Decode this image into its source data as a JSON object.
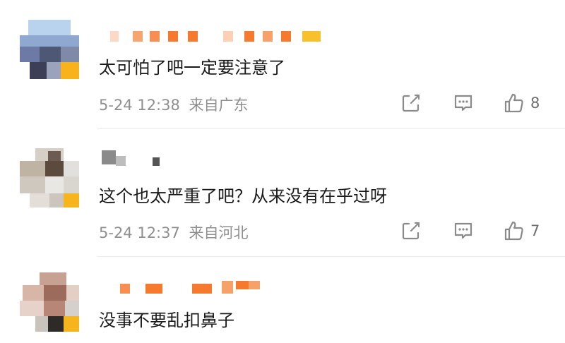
{
  "comments": [
    {
      "text": "太可怕了吧一定要注意了",
      "timestamp": "5-24 12:38",
      "location": "来自广东",
      "likes": "8"
    },
    {
      "text": "这个也太严重了吧？从来没有在乎过呀",
      "timestamp": "5-24 12:37",
      "location": "来自河北",
      "likes": "7"
    },
    {
      "text": "没事不要乱扣鼻子"
    }
  ],
  "colors": {
    "text": "#1a1a1a",
    "meta": "#8f8f8f",
    "nickname_orange": "#f57a2e",
    "nickname_gold": "#f6c12b",
    "icon": "#8a8a8a"
  },
  "icons": [
    "share-icon",
    "comment-icon",
    "like-icon"
  ]
}
